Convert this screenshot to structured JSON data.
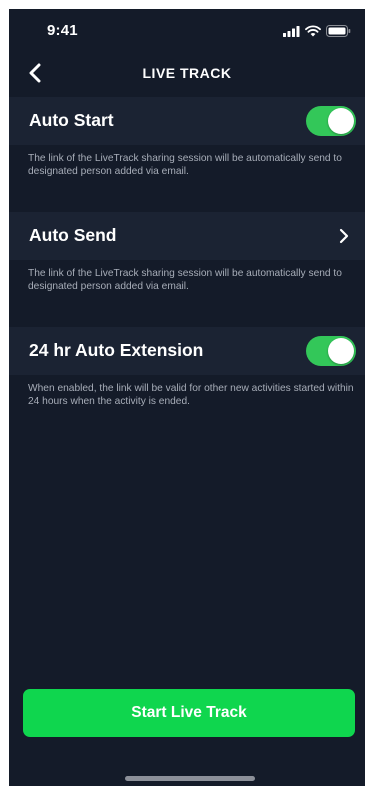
{
  "status_bar": {
    "time": "9:41",
    "icons": [
      "signal-icon",
      "wifi-icon",
      "battery-icon"
    ]
  },
  "header": {
    "back_icon": "chevron-left-icon",
    "title": "LIVE TRACK"
  },
  "settings": [
    {
      "label": "Auto Start",
      "control": "toggle",
      "enabled": true,
      "description": "The link of the LiveTrack sharing session will be automatically send to designated person added via email."
    },
    {
      "label": "Auto Send",
      "control": "chevron-right-icon",
      "description": "The link of the LiveTrack sharing session will be automatically send to designated person added via email."
    },
    {
      "label": "24 hr Auto Extension",
      "control": "toggle",
      "enabled": true,
      "description": "When enabled, the link will be valid for other new activities started within 24 hours when the activity is ended."
    }
  ],
  "primary_action": {
    "label": "Start Live Track"
  },
  "colors": {
    "background": "#141b29",
    "row_background": "#1b2333",
    "toggle_on": "#33c759",
    "button": "#0fd64e",
    "description_text": "#a7adb8"
  }
}
